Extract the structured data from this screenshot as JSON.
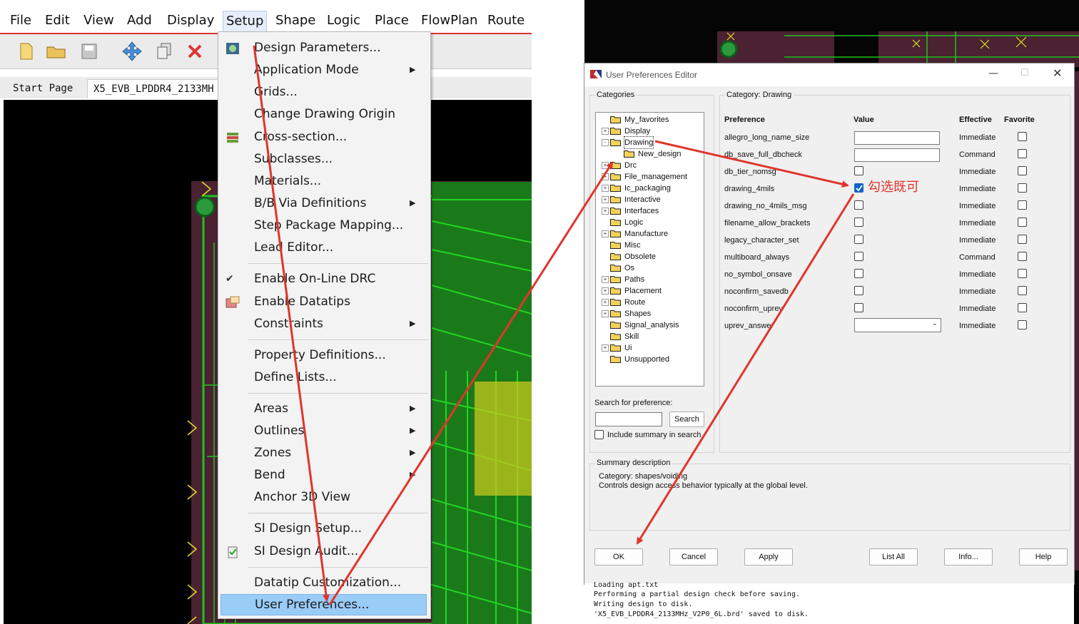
{
  "menubar": {
    "items": [
      "File",
      "Edit",
      "View",
      "Add",
      "Display",
      "Setup",
      "Shape",
      "Logic",
      "Place",
      "FlowPlan",
      "Route"
    ]
  },
  "tabs": {
    "start": "Start Page",
    "design": "X5_EVB_LPDDR4_2133MH"
  },
  "setup_menu": {
    "items": [
      {
        "label": "Design Parameters...",
        "submenu": false
      },
      {
        "label": "Application Mode",
        "submenu": true
      },
      {
        "label": "Grids...",
        "submenu": false
      },
      {
        "label": "Change Drawing Origin",
        "submenu": false
      },
      {
        "label": "Cross-section...",
        "submenu": false
      },
      {
        "label": "Subclasses...",
        "submenu": false
      },
      {
        "label": "Materials...",
        "submenu": false
      },
      {
        "label": "B/B Via Definitions",
        "submenu": true
      },
      {
        "label": "Step Package Mapping...",
        "submenu": false
      },
      {
        "label": "Lead Editor...",
        "submenu": false
      },
      {
        "label": "Enable On-Line DRC",
        "submenu": false
      },
      {
        "label": "Enable Datatips",
        "submenu": false
      },
      {
        "label": "Constraints",
        "submenu": true
      },
      {
        "label": "Property Definitions...",
        "submenu": false
      },
      {
        "label": "Define Lists...",
        "submenu": false
      },
      {
        "label": "Areas",
        "submenu": true
      },
      {
        "label": "Outlines",
        "submenu": true
      },
      {
        "label": "Zones",
        "submenu": true
      },
      {
        "label": "Bend",
        "submenu": true
      },
      {
        "label": "Anchor 3D View",
        "submenu": false
      },
      {
        "label": "SI Design Setup...",
        "submenu": false
      },
      {
        "label": "SI Design Audit...",
        "submenu": false
      },
      {
        "label": "Datatip Customization...",
        "submenu": false
      },
      {
        "label": "User Preferences...",
        "submenu": false
      }
    ]
  },
  "dialog": {
    "title": "User Preferences Editor",
    "categories_label": "Categories",
    "category_prefix": "Category:",
    "category_value": "Drawing",
    "tree": [
      {
        "label": "My_favorites",
        "expander": "",
        "indent": 0
      },
      {
        "label": "Display",
        "expander": "+",
        "indent": 0
      },
      {
        "label": "Drawing",
        "expander": "-",
        "indent": 0
      },
      {
        "label": "New_design",
        "expander": "",
        "indent": 1
      },
      {
        "label": "Drc",
        "expander": "+",
        "indent": 0
      },
      {
        "label": "File_management",
        "expander": "+",
        "indent": 0
      },
      {
        "label": "Ic_packaging",
        "expander": "+",
        "indent": 0
      },
      {
        "label": "Interactive",
        "expander": "+",
        "indent": 0
      },
      {
        "label": "Interfaces",
        "expander": "+",
        "indent": 0
      },
      {
        "label": "Logic",
        "expander": "",
        "indent": 0
      },
      {
        "label": "Manufacture",
        "expander": "+",
        "indent": 0
      },
      {
        "label": "Misc",
        "expander": "",
        "indent": 0
      },
      {
        "label": "Obsolete",
        "expander": "",
        "indent": 0
      },
      {
        "label": "Os",
        "expander": "",
        "indent": 0
      },
      {
        "label": "Paths",
        "expander": "+",
        "indent": 0
      },
      {
        "label": "Placement",
        "expander": "+",
        "indent": 0
      },
      {
        "label": "Route",
        "expander": "+",
        "indent": 0
      },
      {
        "label": "Shapes",
        "expander": "+",
        "indent": 0
      },
      {
        "label": "Signal_analysis",
        "expander": "",
        "indent": 0
      },
      {
        "label": "Skill",
        "expander": "",
        "indent": 0
      },
      {
        "label": "Ui",
        "expander": "+",
        "indent": 0
      },
      {
        "label": "Unsupported",
        "expander": "",
        "indent": 0
      }
    ],
    "headers": {
      "preference": "Preference",
      "value": "Value",
      "effective": "Effective",
      "favorite": "Favorite"
    },
    "rows": [
      {
        "name": "allegro_long_name_size",
        "type": "text",
        "value": "",
        "checked": false,
        "effective": "Immediate"
      },
      {
        "name": "db_save_full_dbcheck",
        "type": "text",
        "value": "",
        "checked": false,
        "effective": "Command"
      },
      {
        "name": "db_tier_nomsg",
        "type": "check",
        "value": "",
        "checked": false,
        "effective": "Immediate"
      },
      {
        "name": "drawing_4mils",
        "type": "check",
        "value": "",
        "checked": true,
        "effective": "Immediate"
      },
      {
        "name": "drawing_no_4mils_msg",
        "type": "check",
        "value": "",
        "checked": false,
        "effective": "Immediate"
      },
      {
        "name": "filename_allow_brackets",
        "type": "check",
        "value": "",
        "checked": false,
        "effective": "Immediate"
      },
      {
        "name": "legacy_character_set",
        "type": "check",
        "value": "",
        "checked": false,
        "effective": "Immediate"
      },
      {
        "name": "multiboard_always",
        "type": "check",
        "value": "",
        "checked": false,
        "effective": "Command"
      },
      {
        "name": "no_symbol_onsave",
        "type": "check",
        "value": "",
        "checked": false,
        "effective": "Immediate"
      },
      {
        "name": "noconfirm_savedb",
        "type": "check",
        "value": "",
        "checked": false,
        "effective": "Immediate"
      },
      {
        "name": "noconfirm_uprev",
        "type": "check",
        "value": "",
        "checked": false,
        "effective": "Immediate"
      },
      {
        "name": "uprev_answer",
        "type": "select",
        "value": "",
        "checked": false,
        "effective": "Immediate"
      }
    ],
    "search_label": "Search for preference:",
    "search_value": "",
    "search_button": "Search",
    "include_summary": "Include summary in search",
    "summary_label": "Summary description",
    "summary_category": "Category: shapes/voiding",
    "summary_text": "Controls design access behavior typically at the global level.",
    "buttons": [
      "OK",
      "Cancel",
      "Apply",
      "List All",
      "Info...",
      "Help"
    ]
  },
  "annotation": "勾选既可",
  "console_lines": [
    "Loading apt.txt",
    "Performing a partial design check before saving.",
    "Writing design to disk.",
    "'X5_EVB_LPDDR4_2133MHz_V2P0_6L.brd' saved to disk."
  ],
  "colors": {
    "annotation_red": "#e0352b",
    "highlight": "#99ccf7",
    "checkbox_blue": "#1463c8",
    "pcb_green": "#1fc21f",
    "pcb_purple": "#5a2a3a"
  }
}
